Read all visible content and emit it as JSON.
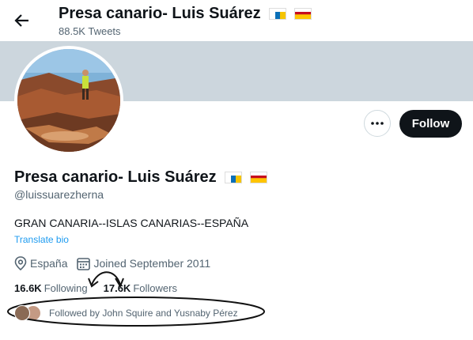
{
  "header": {
    "title": "Presa canario- Luis Suárez",
    "subtitle": "88.5K Tweets",
    "back_icon": "arrow-left-icon"
  },
  "profile": {
    "name": "Presa canario- Luis Suárez",
    "handle": "@luissuarezherna",
    "bio": "GRAN CANARIA--ISLAS CANARIAS--ESPAÑA",
    "translate_label": "Translate bio",
    "location": "España",
    "joined": "Joined September 2011",
    "following_count": "16.6K",
    "following_label": "Following",
    "followers_count": "17.6K",
    "followers_label": "Followers",
    "followed_by": "Followed by John Squire and Yusnaby Pérez"
  },
  "actions": {
    "more_icon": "more-horizontal-icon",
    "follow_label": "Follow"
  },
  "colors": {
    "banner": "#ccd6dd",
    "link": "#1d9bf0",
    "follow_bg": "#0f1419",
    "muted": "#536471"
  }
}
